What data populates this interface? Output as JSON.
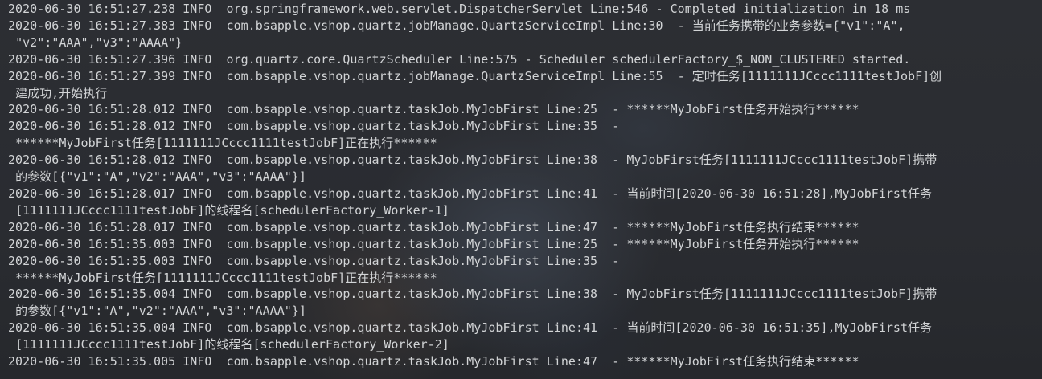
{
  "console": {
    "lines": [
      "2020-06-30 16:51:27.238 INFO  org.springframework.web.servlet.DispatcherServlet Line:546 - Completed initialization in 18 ms",
      "2020-06-30 16:51:27.383 INFO  com.bsapple.vshop.quartz.jobManage.QuartzServiceImpl Line:30  - 当前任务携带的业务参数={\"v1\":\"A\",",
      " \"v2\":\"AAA\",\"v3\":\"AAAA\"}",
      "2020-06-30 16:51:27.396 INFO  org.quartz.core.QuartzScheduler Line:575 - Scheduler schedulerFactory_$_NON_CLUSTERED started.",
      "2020-06-30 16:51:27.399 INFO  com.bsapple.vshop.quartz.jobManage.QuartzServiceImpl Line:55  - 定时任务[1111111JCccc1111testJobF]创",
      " 建成功,开始执行",
      "2020-06-30 16:51:28.012 INFO  com.bsapple.vshop.quartz.taskJob.MyJobFirst Line:25  - ******MyJobFirst任务开始执行******",
      "2020-06-30 16:51:28.012 INFO  com.bsapple.vshop.quartz.taskJob.MyJobFirst Line:35  -",
      " ******MyJobFirst任务[1111111JCccc1111testJobF]正在执行******",
      "2020-06-30 16:51:28.012 INFO  com.bsapple.vshop.quartz.taskJob.MyJobFirst Line:38  - MyJobFirst任务[1111111JCccc1111testJobF]携带",
      " 的参数[{\"v1\":\"A\",\"v2\":\"AAA\",\"v3\":\"AAAA\"}]",
      "2020-06-30 16:51:28.017 INFO  com.bsapple.vshop.quartz.taskJob.MyJobFirst Line:41  - 当前时间[2020-06-30 16:51:28],MyJobFirst任务",
      " [1111111JCccc1111testJobF]的线程名[schedulerFactory_Worker-1]",
      "2020-06-30 16:51:28.017 INFO  com.bsapple.vshop.quartz.taskJob.MyJobFirst Line:47  - ******MyJobFirst任务执行结束******",
      "2020-06-30 16:51:35.003 INFO  com.bsapple.vshop.quartz.taskJob.MyJobFirst Line:25  - ******MyJobFirst任务开始执行******",
      "2020-06-30 16:51:35.003 INFO  com.bsapple.vshop.quartz.taskJob.MyJobFirst Line:35  -",
      " ******MyJobFirst任务[1111111JCccc1111testJobF]正在执行******",
      "2020-06-30 16:51:35.004 INFO  com.bsapple.vshop.quartz.taskJob.MyJobFirst Line:38  - MyJobFirst任务[1111111JCccc1111testJobF]携带",
      " 的参数[{\"v1\":\"A\",\"v2\":\"AAA\",\"v3\":\"AAAA\"}]",
      "2020-06-30 16:51:35.004 INFO  com.bsapple.vshop.quartz.taskJob.MyJobFirst Line:41  - 当前时间[2020-06-30 16:51:35],MyJobFirst任务",
      " [1111111JCccc1111testJobF]的线程名[schedulerFactory_Worker-2]",
      "2020-06-30 16:51:35.005 INFO  com.bsapple.vshop.quartz.taskJob.MyJobFirst Line:47  - ******MyJobFirst任务执行结束******"
    ]
  }
}
